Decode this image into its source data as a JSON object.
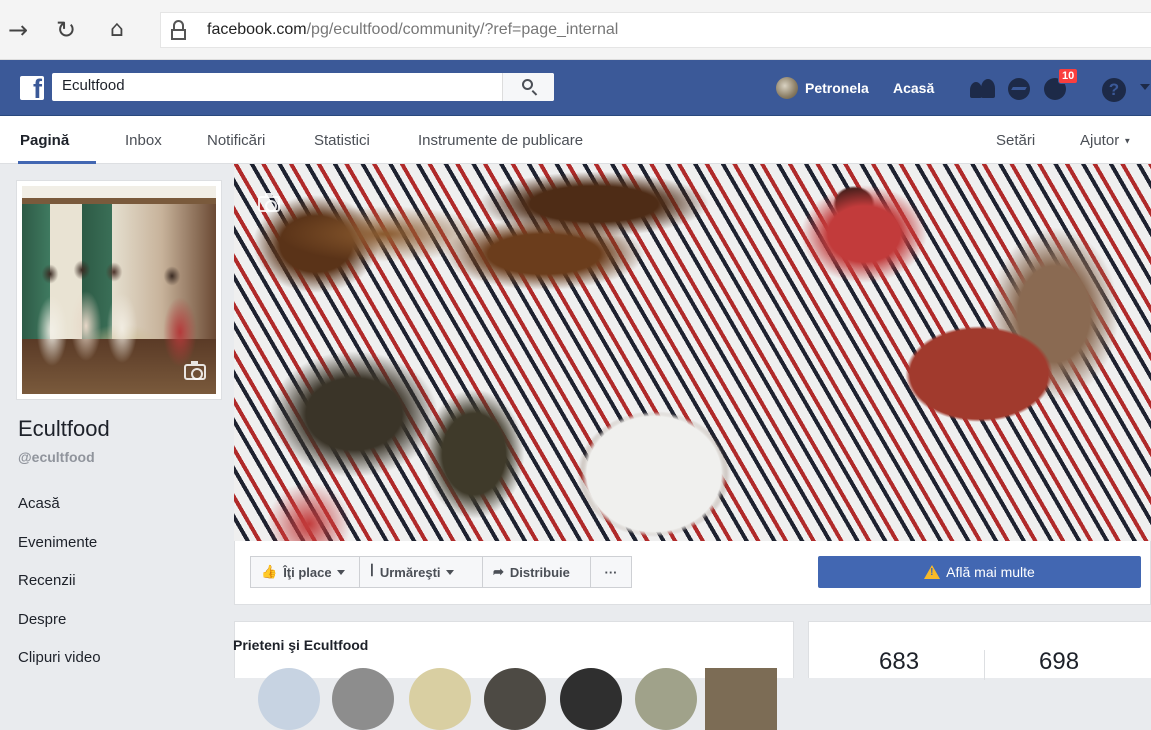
{
  "browser": {
    "url_domain": "facebook.com",
    "url_path": "/pg/ecultfood/community/?ref=page_internal"
  },
  "topbar": {
    "search_value": "Ecultfood",
    "user_name": "Petronela",
    "home_label": "Acasă",
    "notification_count": "10"
  },
  "page_nav": {
    "tabs": [
      "Pagină",
      "Inbox",
      "Notificări",
      "Statistici",
      "Instrumente de publicare"
    ],
    "settings_label": "Setări",
    "help_label": "Ajutor",
    "help_caret": "▼"
  },
  "sidebar": {
    "page_name": "Ecultfood",
    "page_handle": "@ecultfood",
    "items": [
      "Acasă",
      "Evenimente",
      "Recenzii",
      "Despre",
      "Clipuri video"
    ]
  },
  "actions": {
    "like_label": "Îţi place",
    "follow_label": "Urmăreşti",
    "share_label": "Distribuie",
    "more_label": "···",
    "cta_label": "Află mai multe"
  },
  "friends": {
    "title": "Prieteni şi Ecultfood"
  },
  "stats": {
    "values": [
      "683",
      "698"
    ]
  },
  "colors": {
    "facebook_blue": "#3b5998",
    "cta_blue": "#4267b2",
    "badge_red": "#fa3e3e"
  },
  "icons": [
    "back-arrow-icon",
    "reload-icon",
    "home-icon",
    "lock-icon",
    "search-icon",
    "friends-icon",
    "messenger-icon",
    "notifications-icon",
    "help-icon",
    "camera-icon",
    "thumbs-up-icon",
    "rss-icon",
    "share-arrow-icon",
    "warning-icon"
  ]
}
